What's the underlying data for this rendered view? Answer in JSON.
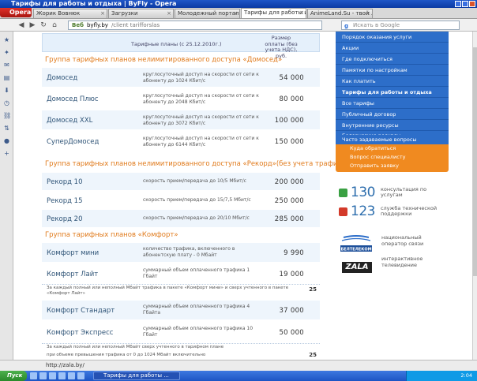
{
  "window": {
    "title": "Тарифы для работы и отдыха | ByFly - Opera"
  },
  "tabs": {
    "opera_label": "Opera",
    "items": [
      {
        "label": "Жорик Вовнюк"
      },
      {
        "label": "Загрузки"
      },
      {
        "label": "Молодежный портал ..."
      },
      {
        "label": "Тарифы для работы и..."
      },
      {
        "label": "AnimeLand.Su - твой ..."
      }
    ]
  },
  "address": {
    "prefix": "Веб",
    "host": "byfly.by",
    "path": "/client tarifforslas"
  },
  "search": {
    "placeholder": "Искать в Google"
  },
  "table": {
    "header_plan": "Тарифные планы (с 25.12.2010г.)",
    "header_price": "Размер оплаты (без учета НДС), руб.",
    "group1_title": "Группа тарифных планов нелимитированного доступа «Домосед»",
    "group1": [
      {
        "name": "Домосед",
        "desc": "круглосуточный доступ на скорости от сети к абоненту до 1024 Кбит/с",
        "price": "54 000"
      },
      {
        "name": "Домосед Плюс",
        "desc": "круглосуточный доступ на скорости от сети к абоненту до 2048 Кбит/с",
        "price": "80 000"
      },
      {
        "name": "Домосед XXL",
        "desc": "круглосуточный доступ на скорости от сети к абоненту до 3072 Кбит/с",
        "price": "100 000"
      },
      {
        "name": "СуперДомосед",
        "desc": "круглосуточный доступ на скорости от сети к абоненту до 6144 Кбит/с",
        "price": "150 000"
      }
    ],
    "group2_title": "Группа тарифных планов нелимитированного доступа «Рекорд»(без учета трафика)",
    "group2": [
      {
        "name": "Рекорд 10",
        "desc": "скорость прием/передача до 10/5 Мбит/с",
        "price": "200 000"
      },
      {
        "name": "Рекорд 15",
        "desc": "скорость прием/передача до 15/7,5 Мбит/с",
        "price": "250 000"
      },
      {
        "name": "Рекорд 20",
        "desc": "скорость прием/передача до 20/10 Мбит/с",
        "price": "285 000"
      }
    ],
    "group3_title": "Группа тарифных планов «Комфорт»",
    "group3": [
      {
        "name": "Комфорт мини",
        "desc": "количество трафика, включенного в абонентскую плату - 0 Мбайт",
        "price": "9 990"
      },
      {
        "name": "Комфорт Лайт",
        "desc": "суммарный объем оплаченного трафика 1 Гбайт",
        "price": "19 000"
      }
    ],
    "note1": "За каждый полный или неполный Мбайт трафика в пакете «Комфорт мини» и сверх учтенного в пакете «Комфорт Лайт»",
    "note1_val": "25",
    "group3b": [
      {
        "name": "Комфорт Стандарт",
        "desc": "суммарный объем оплаченного трафика 4 Гбайта",
        "price": "37 000"
      },
      {
        "name": "Комфорт Экспресс",
        "desc": "суммарный объем оплаченного трафика 10 Гбайт",
        "price": "50 000"
      }
    ],
    "note2": "За каждый полный или неполный Мбайт сверх учтенного в тарифном плане",
    "note3": "при объеме превышения трафика от 0 до 1024 Мбайт включительно",
    "note3_val": "25"
  },
  "sidebar": {
    "items": [
      "Порядок оказания услуги",
      "Акции",
      "Где подключиться",
      "Памятки по настройкам",
      "Как платить",
      "Тарифы для работы и отдыха",
      "Все тарифы",
      "Публичный договор",
      "Внутренние ресурсы",
      "Белорусские ресурсы",
      "Часто задаваемые вопросы"
    ],
    "orange_items": [
      "Куда обратиться",
      "Вопрос специалисту",
      "Отправить заявку"
    ],
    "phone1_num": "130",
    "phone1_text": "консультация по услугам",
    "phone2_num": "123",
    "phone2_text": "служба технической поддержки",
    "beltel_text": "национальный оператор связи",
    "zala_logo": "ZALA",
    "zala_text": "интерактивное телевидение",
    "accent_blue": "#2d6ec9",
    "accent_orange": "#f08a20"
  },
  "status": {
    "url": "http://zala.by/"
  },
  "taskbar": {
    "start": "Пуск",
    "window_btn": "Тарифы для работы ...",
    "time": "2:04"
  }
}
